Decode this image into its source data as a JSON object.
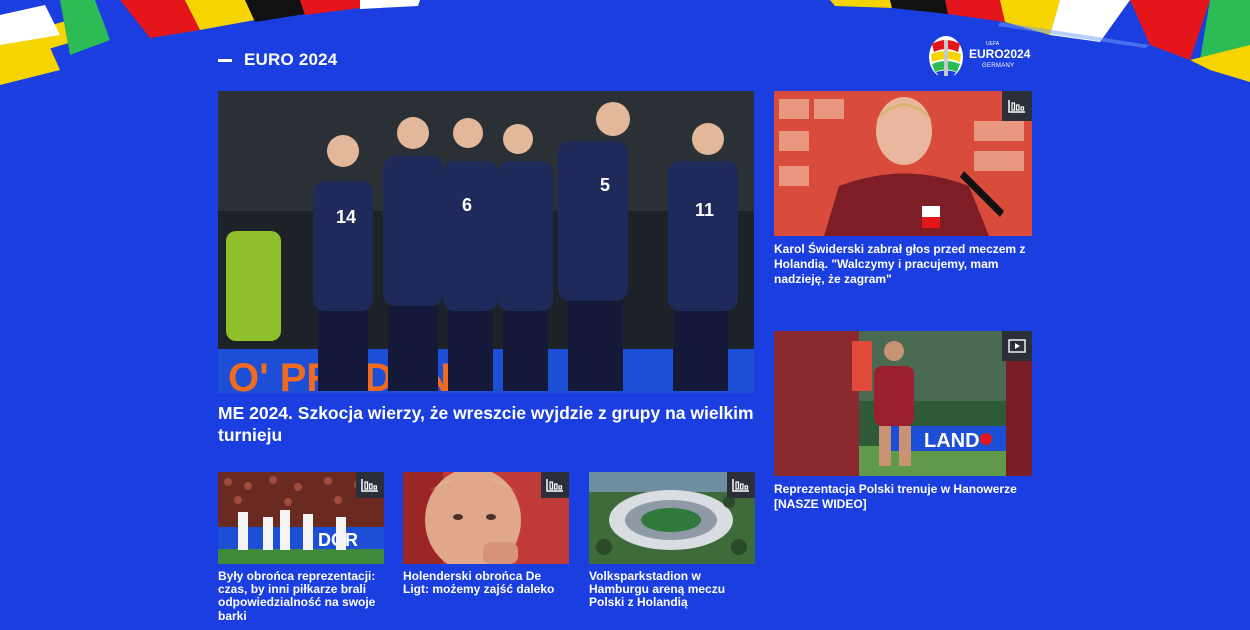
{
  "section": {
    "title": "EURO 2024"
  },
  "logo": {
    "uefa": "UEFA",
    "name": "EURO2024",
    "sub": "GERMANY"
  },
  "main_article": {
    "caption": "ME 2024. Szkocja wierzy, że wreszcie wyjdzie z grupy na wielkim turnieju"
  },
  "side_articles": [
    {
      "caption": "Karol Świderski zabrał głos przed meczem z Holandią. \"Walczymy i pracujemy, mam nadzieję, że zagram\"",
      "badge": "gallery-icon"
    },
    {
      "caption": "Reprezentacja Polski trenuje w Hanowerze [NASZE WIDEO]",
      "badge": "video-icon"
    }
  ],
  "small_articles": [
    {
      "caption": "Były obrońca reprezentacji: czas, by inni piłkarze brali odpowiedzialność na swoje barki",
      "badge": "gallery-icon"
    },
    {
      "caption": "Holenderski obrońca De Ligt: możemy zajść daleko",
      "badge": "gallery-icon"
    },
    {
      "caption": "Volksparkstadion w Hamburgu areną meczu Polski z Holandią",
      "badge": "gallery-icon"
    }
  ],
  "colors": {
    "background": "#1a3ee0",
    "badge": "#2a2f3a"
  }
}
